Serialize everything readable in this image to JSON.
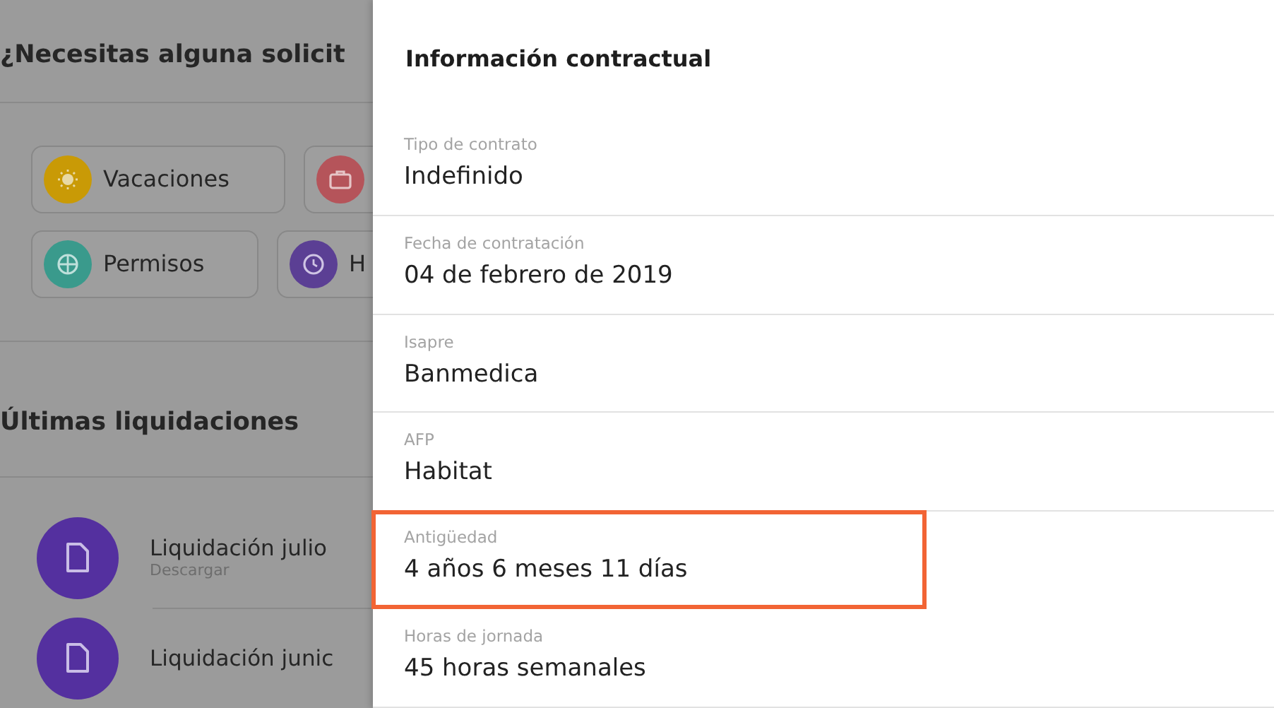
{
  "background": {
    "requests_title": "¿Necesitas alguna solicit",
    "request_buttons": [
      {
        "label": "Vacaciones",
        "color": "#c99a06"
      },
      {
        "color": "#b5545a"
      },
      {
        "label": "Permisos",
        "color": "#3a9a8c"
      },
      {
        "label": "H",
        "color": "#5b3f94"
      }
    ],
    "payslips_title": "Últimas liquidaciones",
    "payslips": [
      {
        "title": "Liquidación julio",
        "action": "Descargar"
      },
      {
        "title": "Liquidación junic"
      }
    ]
  },
  "drawer": {
    "title": "Información contractual",
    "fields": [
      {
        "label": "Tipo de contrato",
        "value": "Indefinido",
        "highlighted": false
      },
      {
        "label": "Fecha de contratación",
        "value": "04 de febrero de 2019",
        "highlighted": false
      },
      {
        "label": "Isapre",
        "value": "Banmedica",
        "highlighted": false
      },
      {
        "label": "AFP",
        "value": "Habitat",
        "highlighted": false
      },
      {
        "label": "Antigüedad",
        "value": "4 años 6 meses 11 días",
        "highlighted": true
      },
      {
        "label": "Horas de jornada",
        "value": "45 horas semanales",
        "highlighted": false
      }
    ]
  }
}
